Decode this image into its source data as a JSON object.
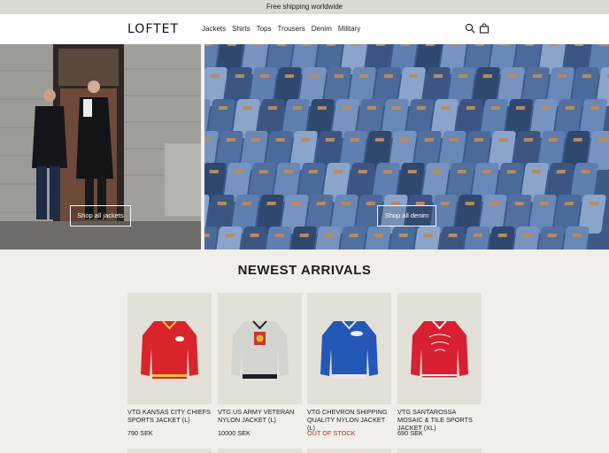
{
  "announcement": "Free shipping worldwide",
  "header": {
    "logo": "LOFTET",
    "nav": [
      "Jackets",
      "Shirts",
      "Tops",
      "Trousers",
      "Denim",
      "Military"
    ],
    "icons": [
      "search-icon",
      "bag-icon"
    ]
  },
  "hero": {
    "left_button": "Shop all jackets",
    "right_button": "Shop all denim"
  },
  "section": {
    "title": "NEWEST ARRIVALS"
  },
  "products": [
    {
      "name": "VTG KANSAS CITY CHIEFS SPORTS JACKET (L)",
      "price": "790 SEK",
      "color": "#d9242c"
    },
    {
      "name": "VTG US ARMY VETERAN NYLON JACKET (L)",
      "price": "10000 SEK",
      "color": "#d4d4cf"
    },
    {
      "name": "VTG CHEVRON SHIPPING QUALITY NYLON JACKET (L)",
      "price": "OUT OF STOCK",
      "color": "#2357b8"
    },
    {
      "name": "VTG SANTAROSSA MOSAIC & TILE SPORTS JACKET (XL)",
      "price": "690 SEK",
      "color": "#d82030"
    }
  ],
  "colors": {
    "announcement_bg": "#dcd9d0",
    "page_bg": "#f1efe9",
    "out_of_stock": "#c0262c"
  }
}
